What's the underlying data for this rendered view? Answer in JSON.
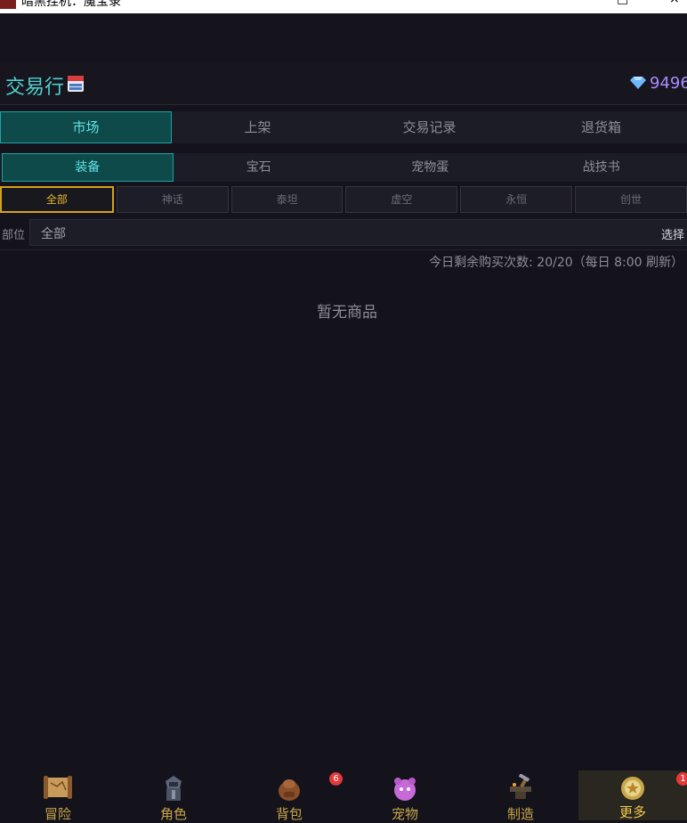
{
  "window": {
    "title": "暗黑挂机：魔宝录",
    "minimize": "□",
    "close": "×"
  },
  "header": {
    "title": "交易行",
    "title_icon": "calendar-24-icon",
    "gems": "9496",
    "gem_icon": "diamond-icon"
  },
  "tabs": [
    "市场",
    "上架",
    "交易记录",
    "退货箱"
  ],
  "category_tabs": [
    "装备",
    "宝石",
    "宠物蛋",
    "战技书"
  ],
  "rarity_filters": [
    "全部",
    "神话",
    "泰坦",
    "虚空",
    "永恒",
    "创世"
  ],
  "slot_filter": {
    "label": "部位",
    "value": "全部",
    "button": "选择"
  },
  "quota_text": "今日剩余购买次数: 20/20（每日 8:00 刷新）",
  "empty_text": "暂无商品",
  "bottom_nav": [
    {
      "label": "冒险",
      "icon": "scroll-map-icon"
    },
    {
      "label": "角色",
      "icon": "knight-icon"
    },
    {
      "label": "背包",
      "icon": "backpack-icon",
      "badge": "6"
    },
    {
      "label": "宠物",
      "icon": "pet-icon"
    },
    {
      "label": "制造",
      "icon": "anvil-icon"
    },
    {
      "label": "更多",
      "icon": "gear-badge-icon",
      "badge": "1"
    }
  ],
  "colors": {
    "accent": "#4fd0cf",
    "gold": "#d4a21a",
    "gem": "#a98bff",
    "badge": "#e23a3a",
    "background": "#14121b"
  }
}
